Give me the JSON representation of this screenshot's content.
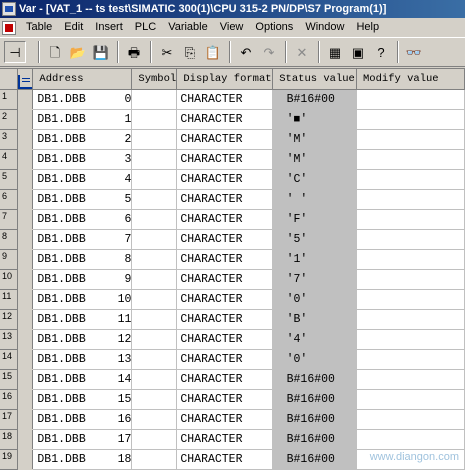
{
  "window": {
    "title": "Var - [VAT_1 -- ts test\\SIMATIC 300(1)\\CPU 315-2 PN/DP\\S7 Program(1)]"
  },
  "menu": [
    "Table",
    "Edit",
    "Insert",
    "PLC",
    "Variable",
    "View",
    "Options",
    "Window",
    "Help"
  ],
  "toolbar": [
    {
      "name": "pin-icon",
      "glyph": "⊣",
      "disabled": false
    },
    {
      "name": "new-icon",
      "glyph": "🗋",
      "disabled": false
    },
    {
      "name": "open-icon",
      "glyph": "📂",
      "disabled": false
    },
    {
      "name": "save-icon",
      "glyph": "💾",
      "disabled": false
    },
    {
      "name": "print-icon",
      "glyph": "🖶",
      "disabled": false
    },
    {
      "name": "cut-icon",
      "glyph": "✂",
      "disabled": false
    },
    {
      "name": "copy-icon",
      "glyph": "⎘",
      "disabled": false
    },
    {
      "name": "paste-icon",
      "glyph": "📋",
      "disabled": false
    },
    {
      "name": "undo-icon",
      "glyph": "↶",
      "disabled": false
    },
    {
      "name": "redo-icon",
      "glyph": "↷",
      "disabled": true
    },
    {
      "name": "delete-icon",
      "glyph": "✕",
      "disabled": true
    },
    {
      "name": "monitor-icon",
      "glyph": "▦",
      "disabled": false
    },
    {
      "name": "variable-icon",
      "glyph": "▣",
      "disabled": false
    },
    {
      "name": "help-icon",
      "glyph": "?",
      "disabled": false
    },
    {
      "name": "glasses-icon",
      "glyph": "👓",
      "disabled": false
    }
  ],
  "columns": [
    "Address",
    "Symbol",
    "Display format",
    "Status value",
    "Modify value"
  ],
  "rows": [
    {
      "num": "1",
      "addr": "DB1.DBB",
      "offset": "0",
      "symbol": "",
      "format": "CHARACTER",
      "status": "B#16#00",
      "modify": ""
    },
    {
      "num": "2",
      "addr": "DB1.DBB",
      "offset": "1",
      "symbol": "",
      "format": "CHARACTER",
      "status": "'■'",
      "modify": ""
    },
    {
      "num": "3",
      "addr": "DB1.DBB",
      "offset": "2",
      "symbol": "",
      "format": "CHARACTER",
      "status": "'M'",
      "modify": ""
    },
    {
      "num": "4",
      "addr": "DB1.DBB",
      "offset": "3",
      "symbol": "",
      "format": "CHARACTER",
      "status": "'M'",
      "modify": ""
    },
    {
      "num": "5",
      "addr": "DB1.DBB",
      "offset": "4",
      "symbol": "",
      "format": "CHARACTER",
      "status": "'C'",
      "modify": ""
    },
    {
      "num": "6",
      "addr": "DB1.DBB",
      "offset": "5",
      "symbol": "",
      "format": "CHARACTER",
      "status": "' '",
      "modify": ""
    },
    {
      "num": "7",
      "addr": "DB1.DBB",
      "offset": "6",
      "symbol": "",
      "format": "CHARACTER",
      "status": "'F'",
      "modify": ""
    },
    {
      "num": "8",
      "addr": "DB1.DBB",
      "offset": "7",
      "symbol": "",
      "format": "CHARACTER",
      "status": "'5'",
      "modify": ""
    },
    {
      "num": "9",
      "addr": "DB1.DBB",
      "offset": "8",
      "symbol": "",
      "format": "CHARACTER",
      "status": "'1'",
      "modify": ""
    },
    {
      "num": "10",
      "addr": "DB1.DBB",
      "offset": "9",
      "symbol": "",
      "format": "CHARACTER",
      "status": "'7'",
      "modify": ""
    },
    {
      "num": "11",
      "addr": "DB1.DBB",
      "offset": "10",
      "symbol": "",
      "format": "CHARACTER",
      "status": "'0'",
      "modify": ""
    },
    {
      "num": "12",
      "addr": "DB1.DBB",
      "offset": "11",
      "symbol": "",
      "format": "CHARACTER",
      "status": "'B'",
      "modify": ""
    },
    {
      "num": "13",
      "addr": "DB1.DBB",
      "offset": "12",
      "symbol": "",
      "format": "CHARACTER",
      "status": "'4'",
      "modify": ""
    },
    {
      "num": "14",
      "addr": "DB1.DBB",
      "offset": "13",
      "symbol": "",
      "format": "CHARACTER",
      "status": "'0'",
      "modify": ""
    },
    {
      "num": "15",
      "addr": "DB1.DBB",
      "offset": "14",
      "symbol": "",
      "format": "CHARACTER",
      "status": "B#16#00",
      "modify": ""
    },
    {
      "num": "16",
      "addr": "DB1.DBB",
      "offset": "15",
      "symbol": "",
      "format": "CHARACTER",
      "status": "B#16#00",
      "modify": ""
    },
    {
      "num": "17",
      "addr": "DB1.DBB",
      "offset": "16",
      "symbol": "",
      "format": "CHARACTER",
      "status": "B#16#00",
      "modify": ""
    },
    {
      "num": "18",
      "addr": "DB1.DBB",
      "offset": "17",
      "symbol": "",
      "format": "CHARACTER",
      "status": "B#16#00",
      "modify": ""
    },
    {
      "num": "19",
      "addr": "DB1.DBB",
      "offset": "18",
      "symbol": "",
      "format": "CHARACTER",
      "status": "B#16#00",
      "modify": ""
    }
  ],
  "watermark": "www.diangon.com",
  "colors": {
    "title_start": "#0a246a",
    "title_end": "#3a6ea5",
    "status_bg": "#c0c0c0",
    "chrome": "#d4d0c8"
  }
}
